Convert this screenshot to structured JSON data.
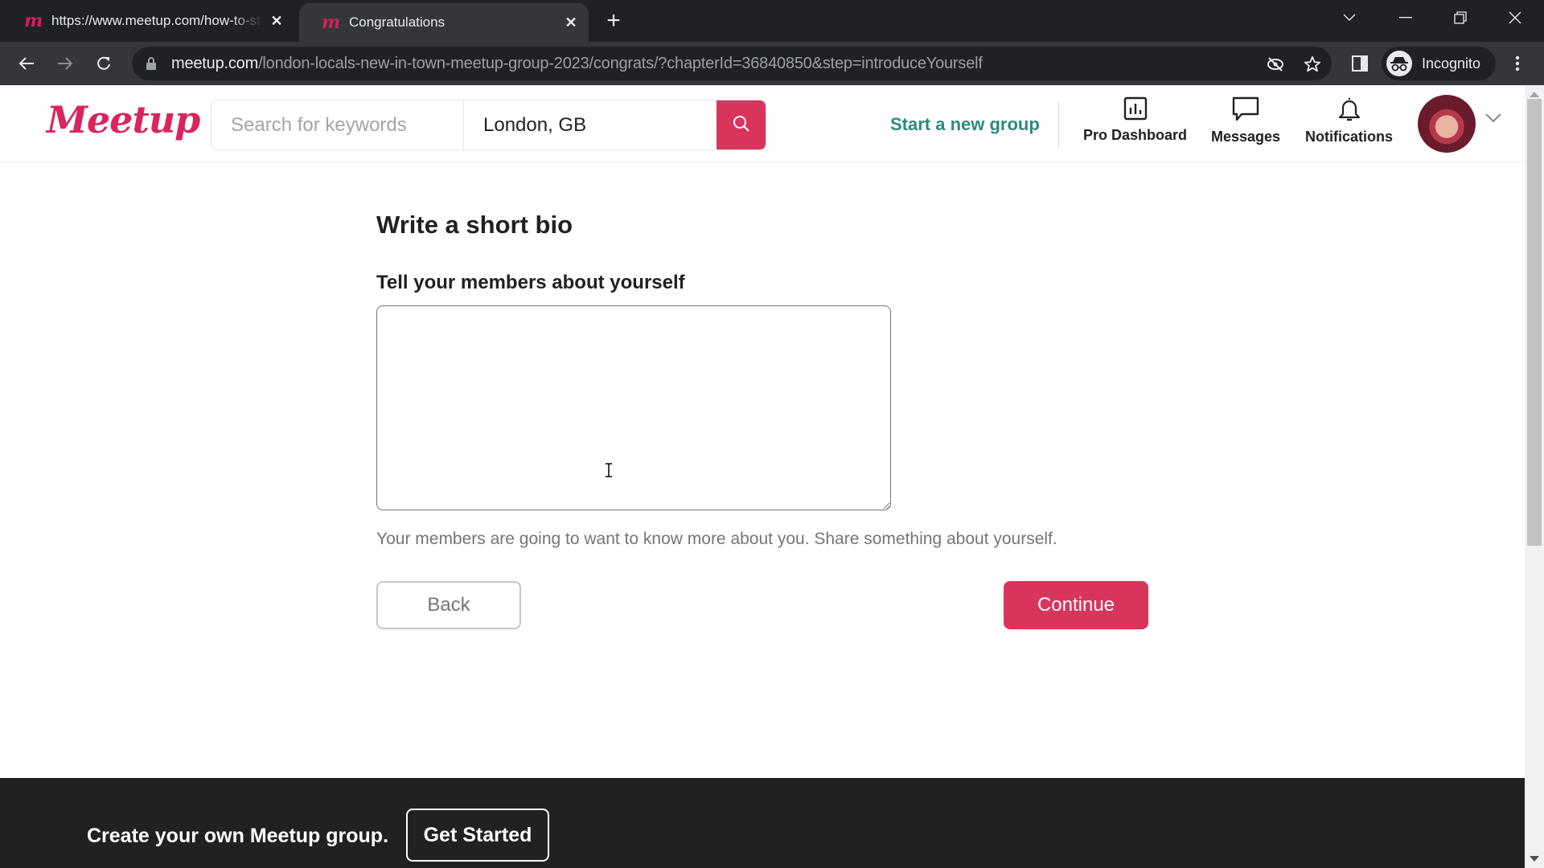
{
  "browser": {
    "tabs": [
      {
        "title": "https://www.meetup.com/how-to-start-a-group",
        "active": false
      },
      {
        "title": "Congratulations",
        "active": true
      }
    ],
    "url_host": "meetup.com",
    "url_path": "/london-locals-new-in-town-meetup-group-2023/congrats/?chapterId=36840850&step=introduceYourself",
    "profile_label": "Incognito"
  },
  "header": {
    "logo": "Meetup",
    "search_placeholder": "Search for keywords",
    "location_value": "London, GB",
    "start_group": "Start a new group",
    "nav": [
      {
        "label": "Pro Dashboard",
        "icon": "chart-icon"
      },
      {
        "label": "Messages",
        "icon": "chat-icon"
      },
      {
        "label": "Notifications",
        "icon": "bell-icon"
      }
    ]
  },
  "main": {
    "title": "Write a short bio",
    "field_label": "Tell your members about yourself",
    "bio_value": "",
    "helper_text": "Your members are going to want to know more about you. Share something about yourself.",
    "back_label": "Back",
    "continue_label": "Continue"
  },
  "footer": {
    "text": "Create your own Meetup group.",
    "button_label": "Get Started"
  },
  "colors": {
    "brand": "#d9245d",
    "primary_button": "#d9345c",
    "link_teal": "#2b8a7e",
    "footer_bg": "#212121"
  }
}
